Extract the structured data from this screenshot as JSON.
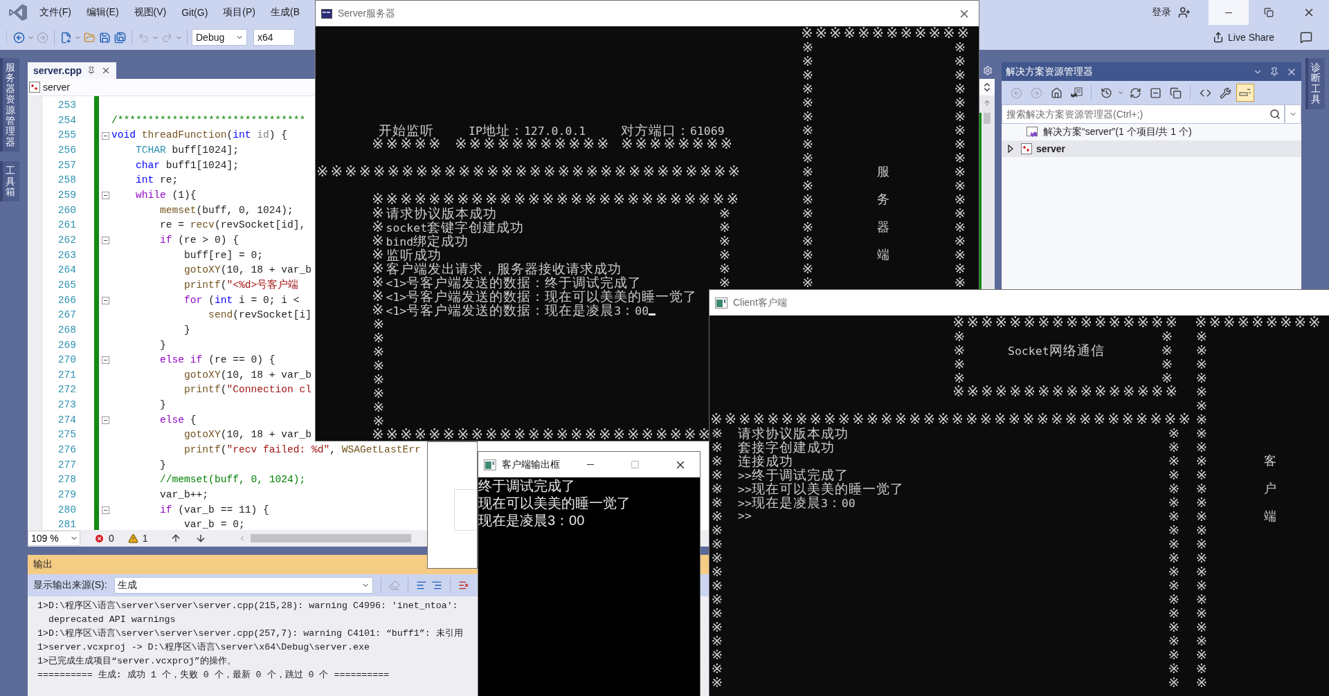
{
  "vs": {
    "menu": [
      "文件(F)",
      "编辑(E)",
      "视图(V)",
      "Git(G)",
      "项目(P)",
      "生成(B"
    ],
    "login": "登录",
    "toolbar_buttons": [
      {
        "disabled": false
      },
      {
        "disabled": true
      },
      {
        "disabled": false
      },
      {
        "disabled": false
      },
      {
        "disabled": false
      },
      {
        "disabled": false
      },
      {
        "disabled": true
      },
      {
        "disabled": true
      }
    ],
    "configuration": "Debug",
    "platform": "x64",
    "live_share": "Live Share",
    "left_tabs": [
      "服务器资源管理器",
      "工具箱"
    ],
    "right_tabs": [
      "诊断工具"
    ]
  },
  "editor": {
    "tabs": [
      {
        "label": "server.cpp",
        "selected": true
      }
    ],
    "navigation": "server",
    "lines": [
      {
        "number": "253",
        "collapsible": false
      },
      {
        "number": "254",
        "collapsible": false,
        "tokens": [
          {
            "kind": "cmt",
            "text": "/*******************************"
          }
        ]
      },
      {
        "number": "255",
        "collapsible": true,
        "tokens": [
          {
            "kind": "kw",
            "text": "void"
          },
          {
            "kind": "fn",
            "text": " threadFunction"
          },
          {
            "kind": "txt",
            "text": "("
          },
          {
            "kind": "kw",
            "text": "int"
          },
          {
            "kind": "param",
            "text": " id"
          },
          {
            "kind": "txt",
            "text": ") {"
          }
        ]
      },
      {
        "number": "256",
        "collapsible": false,
        "tokens": [
          {
            "kind": "type",
            "text": "    TCHAR"
          },
          {
            "kind": "txt",
            "text": " buff[1024];"
          }
        ]
      },
      {
        "number": "257",
        "collapsible": false,
        "tokens": [
          {
            "kind": "kw",
            "text": "    char"
          },
          {
            "kind": "txt",
            "text": " buff1[1024];"
          }
        ]
      },
      {
        "number": "258",
        "collapsible": false,
        "tokens": [
          {
            "kind": "kw",
            "text": "    int"
          },
          {
            "kind": "txt",
            "text": " re;"
          }
        ]
      },
      {
        "number": "259",
        "collapsible": true,
        "tokens": [
          {
            "kind": "ctl",
            "text": "    while"
          },
          {
            "kind": "txt",
            "text": " (1){"
          }
        ]
      },
      {
        "number": "260",
        "collapsible": false,
        "tokens": [
          {
            "kind": "fn",
            "text": "        memset"
          },
          {
            "kind": "txt",
            "text": "(buff, 0, 1024);"
          }
        ]
      },
      {
        "number": "261",
        "collapsible": false,
        "tokens": [
          {
            "kind": "txt",
            "text": "        re ="
          },
          {
            "kind": "fn",
            "text": " recv"
          },
          {
            "kind": "txt",
            "text": "(revSocket[id],"
          }
        ]
      },
      {
        "number": "262",
        "collapsible": true,
        "tokens": [
          {
            "kind": "ctl",
            "text": "        if"
          },
          {
            "kind": "txt",
            "text": " (re > 0) {"
          }
        ]
      },
      {
        "number": "263",
        "collapsible": false,
        "tokens": [
          {
            "kind": "txt",
            "text": "            buff[re] = 0;"
          }
        ]
      },
      {
        "number": "264",
        "collapsible": false,
        "tokens": [
          {
            "kind": "fn",
            "text": "            gotoXY"
          },
          {
            "kind": "txt",
            "text": "(10, 18 + var_b"
          }
        ]
      },
      {
        "number": "265",
        "collapsible": false,
        "tokens": [
          {
            "kind": "fn",
            "text": "            printf"
          },
          {
            "kind": "txt",
            "text": "("
          },
          {
            "kind": "str",
            "text": "\"<%d>号客户端"
          }
        ]
      },
      {
        "number": "266",
        "collapsible": true,
        "tokens": [
          {
            "kind": "ctl",
            "text": "            for"
          },
          {
            "kind": "txt",
            "text": " ("
          },
          {
            "kind": "kw",
            "text": "int"
          },
          {
            "kind": "txt",
            "text": " i = 0; i <"
          }
        ]
      },
      {
        "number": "267",
        "collapsible": false,
        "tokens": [
          {
            "kind": "fn",
            "text": "                send"
          },
          {
            "kind": "txt",
            "text": "(revSocket[i]"
          }
        ]
      },
      {
        "number": "268",
        "collapsible": false,
        "tokens": [
          {
            "kind": "txt",
            "text": "            }"
          }
        ]
      },
      {
        "number": "269",
        "collapsible": false,
        "tokens": [
          {
            "kind": "txt",
            "text": "        }"
          }
        ]
      },
      {
        "number": "270",
        "collapsible": true,
        "tokens": [
          {
            "kind": "ctl",
            "text": "        else if"
          },
          {
            "kind": "txt",
            "text": " (re == 0) {"
          }
        ]
      },
      {
        "number": "271",
        "collapsible": false,
        "tokens": [
          {
            "kind": "fn",
            "text": "            gotoXY"
          },
          {
            "kind": "txt",
            "text": "(10, 18 + var_b"
          }
        ]
      },
      {
        "number": "272",
        "collapsible": false,
        "tokens": [
          {
            "kind": "fn",
            "text": "            printf"
          },
          {
            "kind": "txt",
            "text": "("
          },
          {
            "kind": "str",
            "text": "\"Connection cl"
          }
        ]
      },
      {
        "number": "273",
        "collapsible": false,
        "tokens": [
          {
            "kind": "txt",
            "text": "        }"
          }
        ]
      },
      {
        "number": "274",
        "collapsible": true,
        "tokens": [
          {
            "kind": "ctl",
            "text": "        else"
          },
          {
            "kind": "txt",
            "text": " {"
          }
        ]
      },
      {
        "number": "275",
        "collapsible": false,
        "tokens": [
          {
            "kind": "fn",
            "text": "            gotoXY"
          },
          {
            "kind": "txt",
            "text": "(10, 18 + var_b"
          }
        ]
      },
      {
        "number": "276",
        "collapsible": false,
        "tokens": [
          {
            "kind": "fn",
            "text": "            printf"
          },
          {
            "kind": "txt",
            "text": "("
          },
          {
            "kind": "str",
            "text": "\"recv failed: %d\""
          },
          {
            "kind": "txt",
            "text": ","
          },
          {
            "kind": "fn",
            "text": " WSAGetLastErr"
          }
        ]
      },
      {
        "number": "277",
        "collapsible": false,
        "tokens": [
          {
            "kind": "txt",
            "text": "        }"
          }
        ]
      },
      {
        "number": "278",
        "collapsible": false,
        "tokens": [
          {
            "kind": "cmt",
            "text": "        //memset(buff, 0, 1024);"
          }
        ]
      },
      {
        "number": "279",
        "collapsible": false,
        "tokens": [
          {
            "kind": "txt",
            "text": "        var_b++;"
          }
        ]
      },
      {
        "number": "280",
        "collapsible": true,
        "tokens": [
          {
            "kind": "ctl",
            "text": "        if"
          },
          {
            "kind": "txt",
            "text": " (var_b == 11) {"
          }
        ]
      },
      {
        "number": "281",
        "collapsible": false,
        "tokens": [
          {
            "kind": "txt",
            "text": "            var_b = 0;"
          }
        ]
      }
    ],
    "zoom": "109 %",
    "errors": "0",
    "warnings": "1"
  },
  "output": {
    "title": "输出",
    "source_label": "显示输出来源(S):",
    "source": "生成",
    "lines": [
      {
        "kind": "message",
        "text": "1>D:\\程序区\\语言\\server\\server\\server.cpp(215,28): warning C4996: 'inet_ntoa':"
      },
      {
        "kind": "continuation",
        "text": "deprecated API warnings"
      },
      {
        "kind": "message",
        "text": "1>D:\\程序区\\语言\\server\\server\\server.cpp(257,7): warning C4101: “buff1”: 未引用"
      },
      {
        "kind": "message",
        "text": "1>server.vcxproj -> D:\\程序区\\语言\\server\\x64\\Debug\\server.exe"
      },
      {
        "kind": "message",
        "text": "1>已完成生成项目“server.vcxproj”的操作。"
      },
      {
        "kind": "message",
        "text": "========== 生成: 成功 1 个，失败 0 个，最新 0 个，跳过 0 个 =========="
      }
    ]
  },
  "solution_explorer": {
    "title": "解决方案资源管理器",
    "toolbar": [
      {
        "disabled": true,
        "on": false
      },
      {
        "disabled": true,
        "on": false
      },
      {
        "disabled": false,
        "on": false
      },
      {
        "disabled": false,
        "on": false
      },
      {
        "disabled": false,
        "on": false
      },
      {
        "disabled": false,
        "on": false
      },
      {
        "disabled": false,
        "on": false
      },
      {
        "disabled": false,
        "on": false
      },
      {
        "disabled": false,
        "on": false
      },
      {
        "disabled": false,
        "on": false
      },
      {
        "disabled": false,
        "on": true
      }
    ],
    "search": {
      "placeholder": "搜索解决方案资源管理器(Ctrl+;)"
    },
    "tree": [
      {
        "label": "解决方案“server”(1 个项目/共 1 个)",
        "selected": false,
        "children": [
          {
            "label": "server",
            "selected": true,
            "expanded": false
          }
        ]
      }
    ]
  },
  "server_window": {
    "title": "Server服务器",
    "console": {
      "header": [
        "开始监听",
        "IP地址：127.0.0.1",
        "对方端口：61069"
      ],
      "header_rules": [
        "※※※※※",
        "※※※※※※※※※※※",
        "※※※※※※※※"
      ],
      "separator": "※※※※※※※※※※※※※※※※※※※※※※※※※※※※※※",
      "log_box": {
        "top": "※※※※※※※※※※※※※※※※※※※※※※※※※※",
        "right": "※※※※※※",
        "left": "※※※※※※※※",
        "bottom": "※※※※※※※※※※※※※※※※※※※※※※※※",
        "cursor": true,
        "lines": [
          "※请求协议版本成功",
          "※socket套键字创建成功",
          "※bind绑定成功",
          "※监听成功",
          "※客户端发出请求，服务器接收请求成功",
          "※<1>号客户端发送的数据：终于调试完成了",
          "※<1>号客户端发送的数据：现在可以美美的睡一觉了",
          "※<1>号客户端发送的数据：现在是凌晨3：00"
        ]
      },
      "side_box": {
        "top": "※※※※※※※※※※※※",
        "left": "※※※※※※※※※※※※※※※※※※",
        "right": "※※※※※※※※※※※※※※※※※※",
        "label": "服务器端"
      }
    }
  },
  "client_window": {
    "title": "Client客户端",
    "console": {
      "title_box": {
        "top": "※※※※※※※※※※※※※※※※",
        "left": "※※※※",
        "right": "※※※※",
        "text": "Socket网络通信",
        "bottom": "※※※※※※※※※※※※※※※※"
      },
      "side_box": {
        "top": "※※※※※※※※※",
        "left": "※※※※※※※※※※※※※※※※※※※※※※※※※※",
        "label": "客户端"
      },
      "main_box": {
        "top": "※※※※※※※※※※※※※※※※※※※※※※※※※※※※※※※※※※",
        "left": "※※※※※※※※※※※※※※※※※※※",
        "right": "※※※※※※※※※※※※※※※※※※※",
        "lines": [
          "请求协议版本成功",
          "套接字创建成功",
          "连接成功",
          ">>终于调试完成了",
          ">>现在可以美美的睡一觉了",
          ">>现在是凌晨3：00",
          ">>"
        ]
      }
    }
  },
  "output_window": {
    "title": "客户端输出框",
    "lines": [
      "终于调试完成了",
      "现在可以美美的睡一觉了",
      "现在是凌晨3：00"
    ]
  }
}
